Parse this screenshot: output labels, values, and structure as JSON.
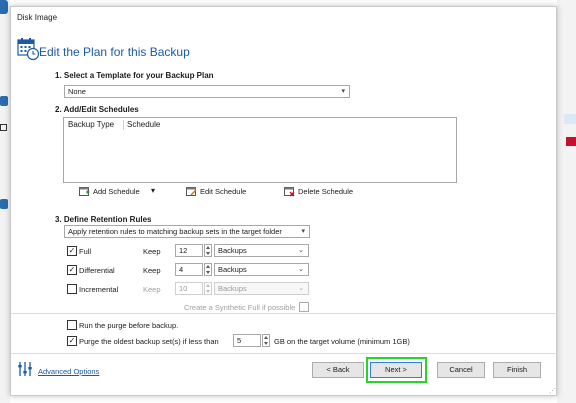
{
  "dialog": {
    "title": "Disk Image",
    "header_title": "Edit the Plan for this Backup"
  },
  "template": {
    "heading": "1. Select a Template for your Backup Plan",
    "selected": "None"
  },
  "schedules": {
    "heading": "2. Add/Edit Schedules",
    "columns": [
      "Backup Type",
      "Schedule"
    ],
    "add_label": "Add Schedule",
    "edit_label": "Edit Schedule",
    "delete_label": "Delete Schedule"
  },
  "retention": {
    "heading": "3. Define Retention Rules",
    "rule_selected": "Apply retention rules to matching backup sets in the target folder",
    "rows": [
      {
        "label": "Full",
        "keep_label": "Keep",
        "keep_value": "12",
        "unit": "Backups",
        "checked": true,
        "enabled": true
      },
      {
        "label": "Differential",
        "keep_label": "Keep",
        "keep_value": "4",
        "unit": "Backups",
        "checked": true,
        "enabled": true
      },
      {
        "label": "Incremental",
        "keep_label": "Keep",
        "keep_value": "10",
        "unit": "Backups",
        "checked": false,
        "enabled": false
      }
    ],
    "synthetic_label": "Create a Synthetic Full if possible"
  },
  "purge": {
    "run_before_label": "Run the purge before backup.",
    "oldest_label": "Purge the oldest backup set(s) if less than",
    "oldest_value": "5",
    "oldest_suffix": "GB on the target volume (minimum 1GB)"
  },
  "footer": {
    "advanced_label": "Advanced Options",
    "back_label": "< Back",
    "next_label": "Next >",
    "cancel_label": "Cancel",
    "finish_label": "Finish"
  },
  "colors": {
    "accent": "#1a5aa6",
    "highlight": "#28d428",
    "background_red_tile": "#c8102e"
  }
}
